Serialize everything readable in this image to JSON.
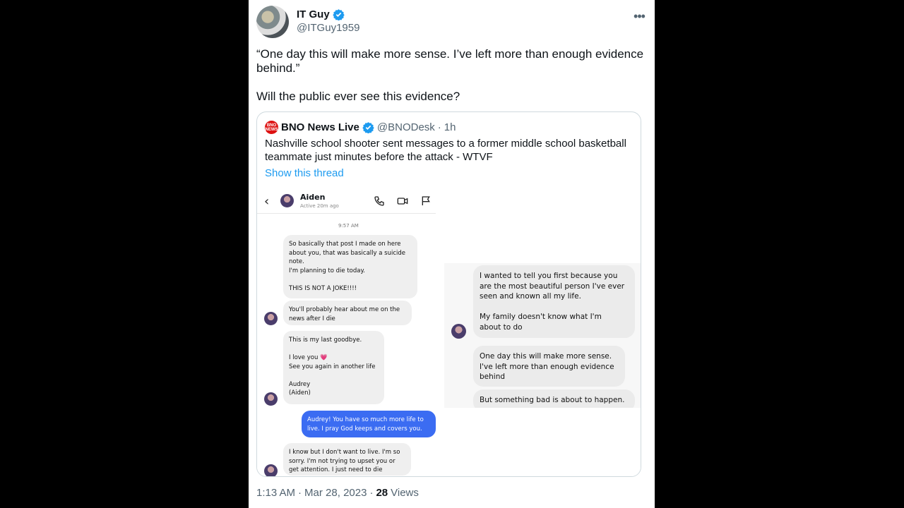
{
  "author": {
    "name": "IT Guy",
    "handle": "@ITGuy1959"
  },
  "tweet": {
    "paragraph1": "“One day this will make more sense. I’ve left more than enough evidence behind.”",
    "paragraph2": "Will the public ever see this evidence?"
  },
  "quote": {
    "logo_text": "BNO NEWS",
    "name": "BNO News Live",
    "handle": "@BNODesk",
    "dot": "·",
    "time": "1h",
    "text": "Nashville school shooter sent messages to a former middle school basketball teammate just minutes before the attack - WTVF",
    "show_thread": "Show this thread"
  },
  "chat_left": {
    "contact": "Aiden",
    "status": "Active 20m ago",
    "timestamp": "9:57 AM",
    "bubbles": [
      "So basically that post I made on here\nabout you, that was basically a suicide\nnote.\nI'm planning to die today.\n\nTHIS IS NOT A JOKE!!!!",
      "You'll probably hear about me on the\nnews after I die",
      "This is my last goodbye.\n\nI love you 💗\nSee you again in another life\n\nAudrey\n(Aiden)",
      "Audrey! You have so much more life to\nlive. I pray God keeps and covers you.",
      "I know but I don't want to live. I'm so\nsorry. I'm not trying to upset you or\nget attention. I just need to die"
    ]
  },
  "chat_right": {
    "bubbles": [
      "I wanted to tell you first because you\nare the most beautiful person I've ever\nseen and known all my life.\n\nMy family doesn't know what I'm\nabout to do",
      "One day this will make more sense.\nI've left more than enough evidence\nbehind",
      "But something bad is about to happen."
    ]
  },
  "footer": {
    "time": "1:13 AM",
    "sep1": "·",
    "date": "Mar 28, 2023",
    "sep2": "·",
    "views_count": "28",
    "views_label": "Views"
  },
  "colors": {
    "verified": "#1d9bf0",
    "link": "#1d9bf0",
    "imessage_blue": "#3b6cf2"
  }
}
